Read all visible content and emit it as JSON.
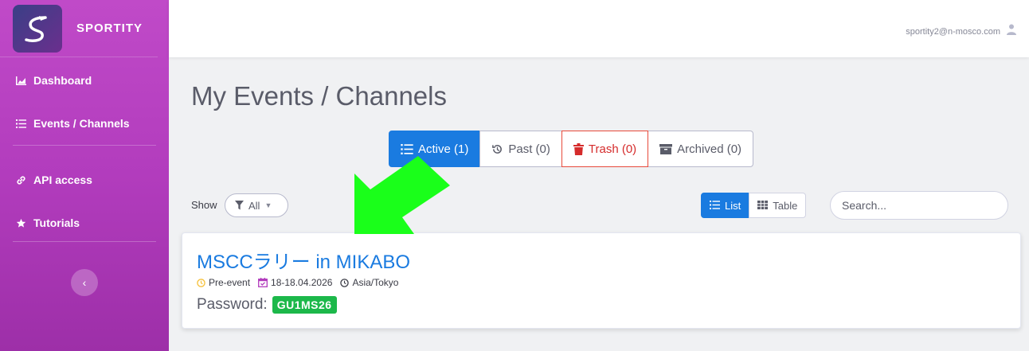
{
  "brand": {
    "name": "SPORTITY"
  },
  "sidebar": {
    "items": [
      {
        "label": "Dashboard",
        "icon": "chart-area-icon"
      },
      {
        "label": "Events / Channels",
        "icon": "list-icon"
      },
      {
        "label": "API access",
        "icon": "link-icon"
      },
      {
        "label": "Tutorials",
        "icon": "star-icon"
      }
    ],
    "collapse_glyph": "‹"
  },
  "topbar": {
    "user_email": "sportity2@n-mosco.com"
  },
  "main": {
    "title": "My Events / Channels",
    "tabs": [
      {
        "label": "Active (1)",
        "icon": "list-icon",
        "state": "active"
      },
      {
        "label": "Past (0)",
        "icon": "history-icon"
      },
      {
        "label": "Trash (0)",
        "icon": "trash-icon"
      },
      {
        "label": "Archived (0)",
        "icon": "archive-icon"
      }
    ],
    "show_label": "Show",
    "filter_value": "All",
    "view": {
      "list_label": "List",
      "table_label": "Table",
      "selected": "List"
    },
    "search": {
      "placeholder": "Search..."
    },
    "events": [
      {
        "title": "MSCCラリー in MIKABO",
        "status": "Pre-event",
        "dates": "18-18.04.2026",
        "timezone": "Asia/Tokyo",
        "password_label": "Password:",
        "password": "GU1MS26"
      }
    ]
  },
  "colors": {
    "primary": "#1a7be0",
    "sidebar": "#b23cbd",
    "success": "#1cb84a",
    "danger": "#e74a3b",
    "warning": "#f6c23e",
    "annotation_arrow": "#1aff1a"
  }
}
